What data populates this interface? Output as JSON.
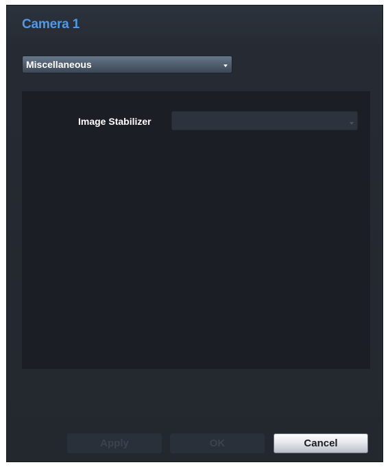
{
  "dialog": {
    "title": "Camera 1"
  },
  "category": {
    "selected": "Miscellaneous",
    "icon": "chevron-down-icon"
  },
  "settings": {
    "image_stabilizer_label": "Image Stabilizer",
    "image_stabilizer_value": ""
  },
  "buttons": {
    "apply": "Apply",
    "ok": "OK",
    "cancel": "Cancel"
  },
  "colors": {
    "title": "#4d9be8",
    "panel": "#1b1e25",
    "dialog_bg": "#262b33"
  }
}
